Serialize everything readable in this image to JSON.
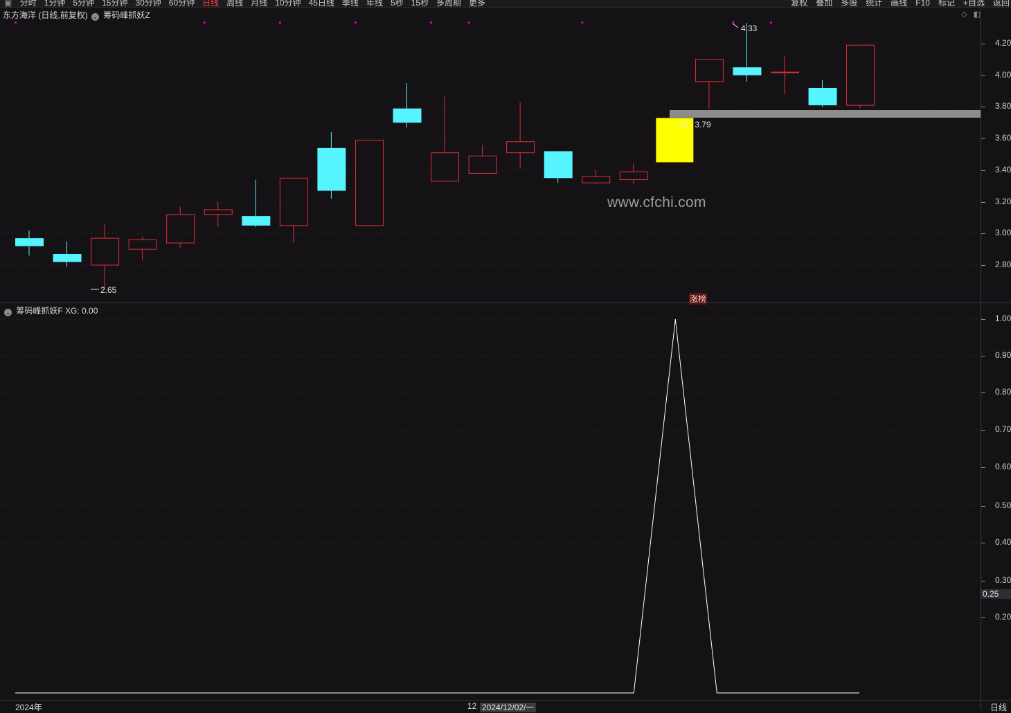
{
  "toolbar": {
    "left_items": [
      "分时",
      "1分钟",
      "5分钟",
      "15分钟",
      "30分钟",
      "60分钟",
      "日线",
      "周线",
      "月线",
      "10分钟",
      "45日线",
      "季线",
      "年线",
      "5秒",
      "15秒",
      "多周期",
      "更多"
    ],
    "active": "日线",
    "right_items": [
      "复权",
      "叠加",
      "多股",
      "统计",
      "画线",
      "F10",
      "标记",
      "+自选",
      "返回"
    ]
  },
  "main_panel": {
    "stock_title": "东方海洋",
    "title_mode": "(日线,前复权)",
    "indicator_name": "筹码峰抓妖Z",
    "high_annotation": "4.33",
    "low_annotation": "2.65",
    "range_label": ".73 - 3.79",
    "watermark": "www.cfchi.com",
    "signal_label": "涨榜",
    "axis_labels": [
      "4.20",
      "4.00",
      "3.80",
      "3.60",
      "3.40",
      "3.20",
      "3.00",
      "2.80"
    ]
  },
  "sub_panel": {
    "indicator_label": "筹码峰抓妖F",
    "value_label": "XG: 0.00",
    "axis_labels": [
      "1.00",
      "0.90",
      "0.80",
      "0.70",
      "0.60",
      "0.50",
      "0.40",
      "0.30",
      "0.20"
    ],
    "current_value": "0.25"
  },
  "footer": {
    "year_label": "2024年",
    "month_label": "12",
    "date_label": "2024/12/02/一",
    "period_label": "日线"
  },
  "colors": {
    "up": "#e0303a",
    "down": "#55f4ff",
    "highlight": "#ffff00",
    "range_bar": "#8c8c8c",
    "xg_line": "#ffffff",
    "marker_dot": "#d000d0"
  },
  "chart_data": {
    "type": "candlestick",
    "ylim": [
      2.6,
      4.4
    ],
    "candles": [
      {
        "o": 2.97,
        "h": 3.02,
        "l": 2.86,
        "c": 2.92
      },
      {
        "o": 2.87,
        "h": 2.95,
        "l": 2.79,
        "c": 2.82
      },
      {
        "o": 2.8,
        "h": 3.06,
        "l": 2.65,
        "c": 2.97
      },
      {
        "o": 2.9,
        "h": 2.98,
        "l": 2.83,
        "c": 2.96
      },
      {
        "o": 2.94,
        "h": 3.17,
        "l": 2.91,
        "c": 3.12
      },
      {
        "o": 3.12,
        "h": 3.2,
        "l": 3.04,
        "c": 3.15
      },
      {
        "o": 3.11,
        "h": 3.34,
        "l": 3.04,
        "c": 3.05
      },
      {
        "o": 3.05,
        "h": 3.35,
        "l": 2.94,
        "c": 3.35
      },
      {
        "o": 3.54,
        "h": 3.64,
        "l": 3.22,
        "c": 3.27
      },
      {
        "o": 3.05,
        "h": 3.59,
        "l": 3.05,
        "c": 3.59
      },
      {
        "o": 3.79,
        "h": 3.95,
        "l": 3.67,
        "c": 3.7
      },
      {
        "o": 3.33,
        "h": 3.87,
        "l": 3.33,
        "c": 3.51
      },
      {
        "o": 3.38,
        "h": 3.56,
        "l": 3.38,
        "c": 3.49
      },
      {
        "o": 3.51,
        "h": 3.83,
        "l": 3.41,
        "c": 3.58
      },
      {
        "o": 3.52,
        "h": 3.52,
        "l": 3.32,
        "c": 3.35
      },
      {
        "o": 3.32,
        "h": 3.4,
        "l": 3.31,
        "c": 3.36
      },
      {
        "o": 3.34,
        "h": 3.44,
        "l": 3.31,
        "c": 3.39
      },
      {
        "o": 3.45,
        "h": 3.73,
        "l": 3.45,
        "c": 3.73
      },
      {
        "o": 3.96,
        "h": 4.1,
        "l": 3.79,
        "c": 4.1
      },
      {
        "o": 4.05,
        "h": 4.33,
        "l": 3.96,
        "c": 4.0
      },
      {
        "o": 4.02,
        "h": 4.12,
        "l": 3.88,
        "c": 4.02
      },
      {
        "o": 3.92,
        "h": 3.97,
        "l": 3.8,
        "c": 3.81
      },
      {
        "o": 3.81,
        "h": 4.19,
        "l": 3.79,
        "c": 4.19
      }
    ],
    "highlight_index": 17,
    "range_band": [
      3.73,
      3.79
    ],
    "marker_indices": [
      0,
      5,
      7,
      9,
      11,
      12,
      15,
      19,
      20
    ],
    "xg_series": [
      0,
      0,
      0,
      0,
      0,
      0,
      0,
      0,
      0,
      0,
      0,
      0,
      0,
      0,
      0,
      0,
      0,
      1,
      0,
      0,
      0,
      0,
      0
    ],
    "xg_ylim": [
      0,
      1
    ]
  }
}
